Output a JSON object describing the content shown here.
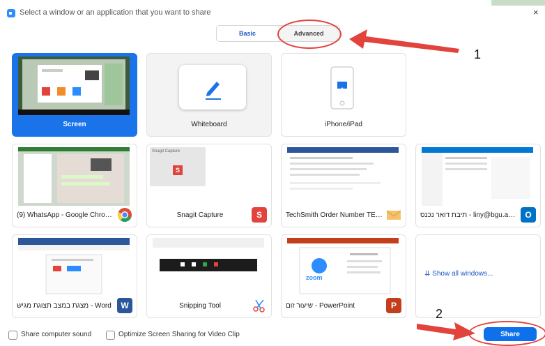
{
  "window": {
    "title": "Select a window or an application that you want to share",
    "close_glyph": "×"
  },
  "tabs": {
    "basic": "Basic",
    "advanced": "Advanced"
  },
  "tiles": [
    {
      "label": "Screen",
      "selected": true
    },
    {
      "label": "Whiteboard"
    },
    {
      "label": "iPhone/iPad"
    },
    {
      "label": "(9) WhatsApp - Google Chrome",
      "icon": "chrome-icon"
    },
    {
      "label": "Snagit Capture",
      "icon": "snagit-icon",
      "icon_text": "S",
      "thumb_text": "Snagit Capture"
    },
    {
      "label": "TechSmith Order Number TEC200...",
      "icon": "outlook-mail-icon"
    },
    {
      "label": "תיבת דואר נכנס - liny@bgu.ac.il ...",
      "icon": "outlook-icon",
      "icon_text": "O"
    },
    {
      "label": "מצגת במצב תצוגת מגיש - Word",
      "icon": "word-icon",
      "icon_text": "W"
    },
    {
      "label": "Snipping Tool",
      "icon": "snipping-tool-icon"
    },
    {
      "label": "שיעור זום - PowerPoint",
      "icon": "powerpoint-icon",
      "icon_text": "P",
      "thumb_text": "zoom"
    },
    {
      "label": "Show all windows...",
      "glyph": "⇊"
    }
  ],
  "footer": {
    "sound": "Share computer sound",
    "optimize": "Optimize Screen Sharing for Video Clip",
    "share": "Share"
  },
  "annotations": {
    "one": "1",
    "two": "2"
  },
  "colors": {
    "accent": "#0e71eb",
    "selected_tile": "#1a73e8",
    "annotation": "#e2433c"
  }
}
